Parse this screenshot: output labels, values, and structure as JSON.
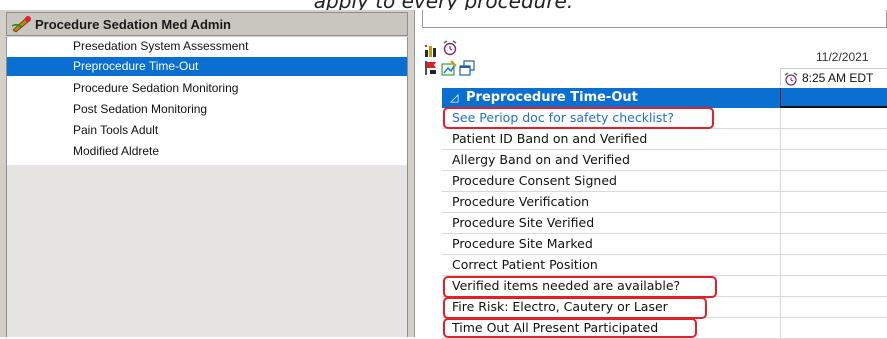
{
  "caption": "apply to every procedure.",
  "left_panel": {
    "header_title": "Procedure Sedation Med Admin",
    "items": [
      {
        "label": "Presedation System Assessment",
        "selected": false
      },
      {
        "label": "Preprocedure Time-Out",
        "selected": true
      },
      {
        "label": "Procedure Sedation Monitoring",
        "selected": false
      },
      {
        "label": "Post Sedation Monitoring",
        "selected": false
      },
      {
        "label": "Pain Tools Adult",
        "selected": false
      },
      {
        "label": "Modified Aldrete",
        "selected": false
      }
    ]
  },
  "right_panel": {
    "date": "11/2/2021",
    "time": "8:25 AM EDT",
    "section_title": "Preprocedure Time-Out",
    "rows": [
      {
        "label": "See Periop doc for safety checklist?",
        "link": true,
        "highlighted": true
      },
      {
        "label": "Patient ID Band on and Verified",
        "link": false,
        "highlighted": false
      },
      {
        "label": "Allergy Band on and Verified",
        "link": false,
        "highlighted": false
      },
      {
        "label": "Procedure Consent Signed",
        "link": false,
        "highlighted": false
      },
      {
        "label": "Procedure Verification",
        "link": false,
        "highlighted": false
      },
      {
        "label": "Procedure Site Verified",
        "link": false,
        "highlighted": false
      },
      {
        "label": "Procedure Site Marked",
        "link": false,
        "highlighted": false
      },
      {
        "label": "Correct Patient Position",
        "link": false,
        "highlighted": false
      },
      {
        "label": "Verified items needed are available?",
        "link": false,
        "highlighted": true
      },
      {
        "label": "Fire Risk: Electro, Cautery or Laser",
        "link": false,
        "highlighted": true
      },
      {
        "label": "Time Out All Present Participated",
        "link": false,
        "highlighted": true
      }
    ]
  },
  "colors": {
    "selection_blue": "#0a6fd1",
    "annotation_red": "#e0202a",
    "link_blue": "#1f6fd0"
  },
  "icons": [
    "procedure-sedation-icon",
    "bar-chart-icon",
    "alarm-clock-icon",
    "flag-icon",
    "edit-chart-icon",
    "copy-window-icon",
    "clock-icon"
  ]
}
